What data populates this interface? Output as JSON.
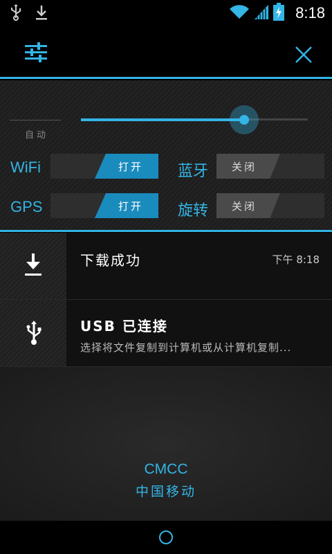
{
  "status_bar": {
    "time": "8:18",
    "icons": [
      "usb-icon",
      "download-icon",
      "wifi-icon",
      "signal-icon",
      "battery-charging-icon"
    ]
  },
  "header": {
    "icons": [
      "settings-sliders-icon",
      "close-icon"
    ]
  },
  "brightness": {
    "auto_label": "自动",
    "level": 0.72
  },
  "toggles": {
    "wifi": {
      "label": "WiFi",
      "state": "打开"
    },
    "bluetooth": {
      "label": "蓝牙",
      "state": "关闭"
    },
    "gps": {
      "label": "GPS",
      "state": "打开"
    },
    "rotate": {
      "label": "旋转",
      "state": "关闭"
    }
  },
  "notifications": [
    {
      "icon": "download-icon",
      "title": "下载成功",
      "time": "下午 8:18"
    },
    {
      "icon": "usb-icon",
      "title": "USB 已连接",
      "text": "选择将文件复制到计算机或从计算机复制..."
    }
  ],
  "carrier": {
    "line1": "CMCC",
    "line2": "中国移动"
  },
  "colors": {
    "accent": "#33b5e5",
    "background": "#000000"
  }
}
